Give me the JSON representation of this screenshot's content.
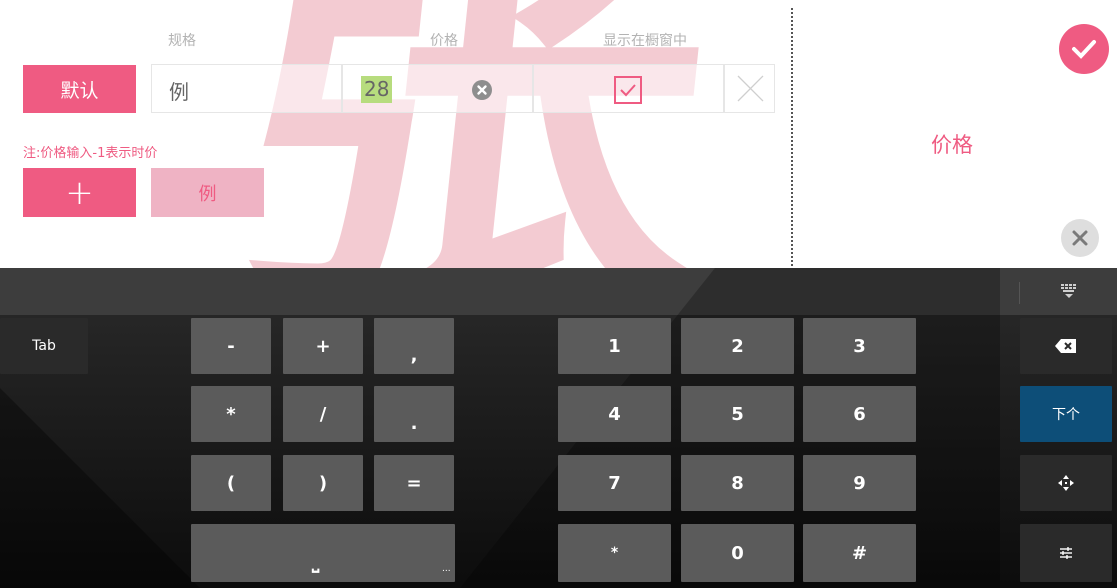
{
  "watermark": "张",
  "table": {
    "headers": {
      "spec": "规格",
      "price": "价格",
      "show_in_window": "显示在橱窗中"
    },
    "default_button": "默认",
    "spec_value": "例",
    "price_value": "28",
    "note": "注:价格输入-1表示时价",
    "add_button": "+",
    "example_button": "例"
  },
  "right_panel": {
    "title": "价格"
  },
  "keyboard": {
    "tab": "Tab",
    "symbol_keys": [
      [
        "-",
        "+",
        ","
      ],
      [
        "*",
        "/",
        "."
      ],
      [
        "(",
        ")",
        "="
      ]
    ],
    "space_key": "⎵",
    "space_ellipsis": "...",
    "number_keys": [
      [
        "1",
        "2",
        "3"
      ],
      [
        "4",
        "5",
        "6"
      ],
      [
        "7",
        "8",
        "9"
      ],
      [
        "*",
        "0",
        "#"
      ]
    ],
    "next_key": "下个",
    "backspace_icon": "backspace-icon",
    "move_icon": "move-icon",
    "settings_icon": "keyboard-settings-icon",
    "hide_icon": "keyboard-hide-icon"
  },
  "colors": {
    "accent": "#ef5b82",
    "next_key": "#0d4e78"
  }
}
